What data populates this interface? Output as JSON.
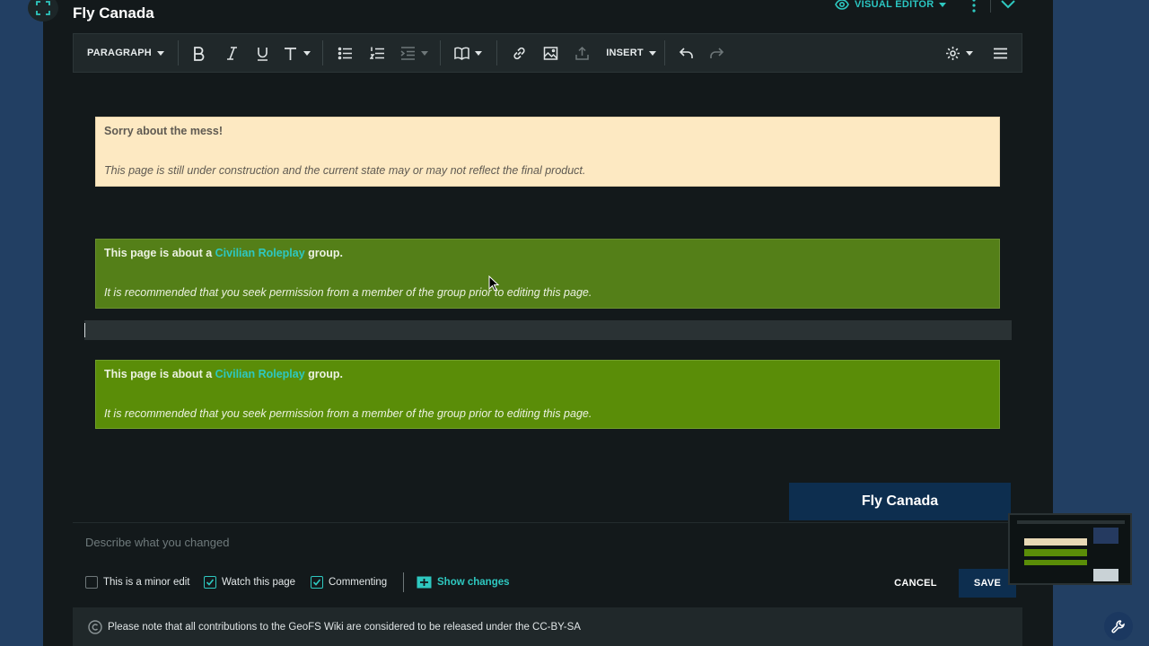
{
  "header": {
    "title": "Fly Canada",
    "visual_editor_label": "VISUAL EDITOR"
  },
  "toolbar": {
    "paragraph_label": "PARAGRAPH",
    "insert_label": "INSERT"
  },
  "notices": [
    {
      "title": "Sorry about the mess!",
      "body": "This page is still under construction and the current state may or may not reflect the final product."
    },
    {
      "title_prefix": "This page is about a ",
      "title_link": "Civilian Roleplay",
      "title_suffix": " group.",
      "body": "It is recommended that you seek permission from a member of the group prior to editing this page."
    },
    {
      "title_prefix": "This page is about a ",
      "title_link": "Civilian Roleplay",
      "title_suffix": " group.",
      "body": "It is recommended that you seek permission from a member of the group prior to editing this page."
    }
  ],
  "infobox": {
    "title": "Fly Canada"
  },
  "summary": {
    "placeholder": "Describe what you changed",
    "value": ""
  },
  "options": {
    "minor_edit": {
      "label": "This is a minor edit",
      "checked": false
    },
    "watch": {
      "label": "Watch this page",
      "checked": true
    },
    "commenting": {
      "label": "Commenting",
      "checked": true
    },
    "show_changes": "Show changes"
  },
  "actions": {
    "cancel": "CANCEL",
    "save": "SAVE"
  },
  "license": {
    "text": "Please note that all contributions to the GeoFS Wiki are considered to be released under the CC-BY-SA"
  },
  "colors": {
    "accent": "#2ec8c0",
    "notice_yellow": "#fde9c2",
    "notice_green": "#5a8d08",
    "primary_button": "#0d2e4f"
  },
  "icons": [
    "expand-icon",
    "eye-icon",
    "kebab-icon",
    "chevron-down-icon",
    "bold-icon",
    "italic-icon",
    "underline-icon",
    "text-style-icon",
    "bullet-list-icon",
    "numbered-list-icon",
    "indent-icon",
    "cite-icon",
    "link-icon",
    "image-icon",
    "upload-icon",
    "undo-icon",
    "redo-icon",
    "gear-icon",
    "menu-icon",
    "diff-icon",
    "copyright-icon",
    "wrench-icon"
  ]
}
